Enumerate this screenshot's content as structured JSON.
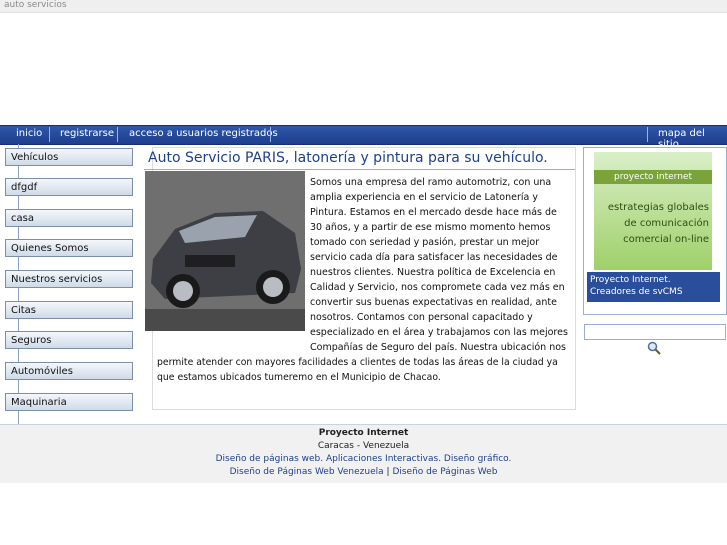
{
  "topbar": {
    "text": "auto servicios"
  },
  "nav": {
    "inicio": "inicio",
    "registrarse": "registrarse",
    "acceso": "acceso a usuarios registrados",
    "mapa": "mapa del sitio"
  },
  "sidebar": {
    "items": [
      "Vehículos",
      "dfgdf",
      "casa",
      "Quienes Somos",
      "Nuestros servicios",
      "Citas",
      "Seguros",
      "Automóviles",
      "Maquinaria"
    ]
  },
  "main": {
    "title": "Auto Servicio PARIS, latonería y pintura para su vehículo.",
    "text_lines": [
      "Somos una empresa del ramo automotriz, con una",
      "amplia experiencia en el servicio de Latonería y",
      "Pintura. Estamos en el mercado desde hace más de",
      "30 años, y a partir de ese mismo momento hemos",
      "tomado con seriedad y pasión, prestar un mejor",
      "servicio cada día para satisfacer las necesidades de",
      "nuestros clientes. Nuestra política de Excelencia en",
      "Calidad y Servicio, nos compromete cada vez más en",
      "convertir sus buenas expectativas en realidad, ante",
      "nosotros. Contamos con personal capacitado y",
      "especializado en el área y trabajamos con las mejores",
      "Compañías de Seguro del país. Nuestra ubicación nos",
      "permite atender con mayores facilidades a clientes de todas las áreas de la ciudad ya",
      "que estamos ubicados tumeremo en el Municipio de Chacao."
    ]
  },
  "ad": {
    "brand": "proyecto internet",
    "line1": "estrategias globales",
    "line2": "de comunicación",
    "line3": "comercial on-line",
    "caption": "Proyecto Internet. Creadores de svCMS"
  },
  "footer": {
    "company": "Proyecto Internet",
    "city": "Caracas - Venezuela",
    "services": "Diseño de páginas web. Aplicaciones Interactivas. Diseño gráfico.",
    "link1": "Diseño de Páginas Web Venezuela",
    "separator": "|",
    "link2": "Diseño de Páginas Web"
  },
  "colors": {
    "nav": "#2f56a8",
    "title": "#1f3f8f",
    "footer_link": "#1f3f8f"
  }
}
